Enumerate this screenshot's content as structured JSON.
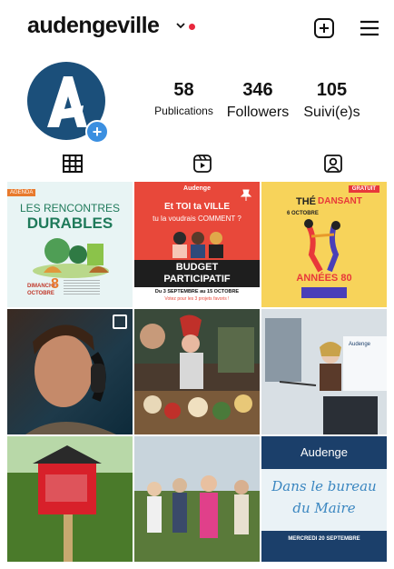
{
  "header": {
    "username": "audengeville",
    "icons": [
      "chevron-down-icon",
      "new-post-icon",
      "menu-icon"
    ],
    "accent": "#e8283d"
  },
  "profile": {
    "avatar_letter": "A",
    "stats": [
      {
        "value": "58",
        "label": "Publications"
      },
      {
        "value": "346",
        "label": "Followers"
      },
      {
        "value": "105",
        "label": "Suivi(e)s"
      }
    ]
  },
  "tabs": [
    "grid-icon",
    "reels-icon",
    "tagged-icon"
  ],
  "posts": {
    "p1": {
      "tag": "AGENDA",
      "title1": "LES RENCONTRES",
      "title2": "DURABLES",
      "day": "DIMANCHE",
      "date": "8",
      "month": "OCTOBRE"
    },
    "p2": {
      "brand": "Audenge",
      "line1": "Et TOI ta VILLE",
      "line2": "tu la voudrais COMMENT ?",
      "title1": "BUDGET",
      "title2": "PARTICIPATIF",
      "dates": "Du 3 SEPTEMBRE au 15 OCTOBRE",
      "sub": "Votez pour les 3 projets favoris !"
    },
    "p3": {
      "badge": "GRATUIT",
      "title1": "THÉ",
      "title2": "DANSANT",
      "date": "6 OCTOBRE",
      "title3": "ANNÉES 80"
    },
    "p9": {
      "brand": "Audenge",
      "line1": "Dans le bureau",
      "line2": "du Maire",
      "date": "MERCREDI 20 SEPTEMBRE"
    }
  }
}
